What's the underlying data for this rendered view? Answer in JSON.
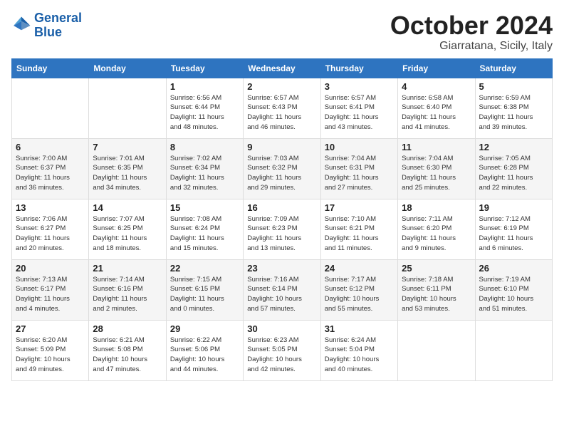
{
  "header": {
    "logo_general": "General",
    "logo_blue": "Blue",
    "month": "October 2024",
    "location": "Giarratana, Sicily, Italy"
  },
  "days_of_week": [
    "Sunday",
    "Monday",
    "Tuesday",
    "Wednesday",
    "Thursday",
    "Friday",
    "Saturday"
  ],
  "weeks": [
    [
      {
        "day": "",
        "info": ""
      },
      {
        "day": "",
        "info": ""
      },
      {
        "day": "1",
        "info": "Sunrise: 6:56 AM\nSunset: 6:44 PM\nDaylight: 11 hours\nand 48 minutes."
      },
      {
        "day": "2",
        "info": "Sunrise: 6:57 AM\nSunset: 6:43 PM\nDaylight: 11 hours\nand 46 minutes."
      },
      {
        "day": "3",
        "info": "Sunrise: 6:57 AM\nSunset: 6:41 PM\nDaylight: 11 hours\nand 43 minutes."
      },
      {
        "day": "4",
        "info": "Sunrise: 6:58 AM\nSunset: 6:40 PM\nDaylight: 11 hours\nand 41 minutes."
      },
      {
        "day": "5",
        "info": "Sunrise: 6:59 AM\nSunset: 6:38 PM\nDaylight: 11 hours\nand 39 minutes."
      }
    ],
    [
      {
        "day": "6",
        "info": "Sunrise: 7:00 AM\nSunset: 6:37 PM\nDaylight: 11 hours\nand 36 minutes."
      },
      {
        "day": "7",
        "info": "Sunrise: 7:01 AM\nSunset: 6:35 PM\nDaylight: 11 hours\nand 34 minutes."
      },
      {
        "day": "8",
        "info": "Sunrise: 7:02 AM\nSunset: 6:34 PM\nDaylight: 11 hours\nand 32 minutes."
      },
      {
        "day": "9",
        "info": "Sunrise: 7:03 AM\nSunset: 6:32 PM\nDaylight: 11 hours\nand 29 minutes."
      },
      {
        "day": "10",
        "info": "Sunrise: 7:04 AM\nSunset: 6:31 PM\nDaylight: 11 hours\nand 27 minutes."
      },
      {
        "day": "11",
        "info": "Sunrise: 7:04 AM\nSunset: 6:30 PM\nDaylight: 11 hours\nand 25 minutes."
      },
      {
        "day": "12",
        "info": "Sunrise: 7:05 AM\nSunset: 6:28 PM\nDaylight: 11 hours\nand 22 minutes."
      }
    ],
    [
      {
        "day": "13",
        "info": "Sunrise: 7:06 AM\nSunset: 6:27 PM\nDaylight: 11 hours\nand 20 minutes."
      },
      {
        "day": "14",
        "info": "Sunrise: 7:07 AM\nSunset: 6:25 PM\nDaylight: 11 hours\nand 18 minutes."
      },
      {
        "day": "15",
        "info": "Sunrise: 7:08 AM\nSunset: 6:24 PM\nDaylight: 11 hours\nand 15 minutes."
      },
      {
        "day": "16",
        "info": "Sunrise: 7:09 AM\nSunset: 6:23 PM\nDaylight: 11 hours\nand 13 minutes."
      },
      {
        "day": "17",
        "info": "Sunrise: 7:10 AM\nSunset: 6:21 PM\nDaylight: 11 hours\nand 11 minutes."
      },
      {
        "day": "18",
        "info": "Sunrise: 7:11 AM\nSunset: 6:20 PM\nDaylight: 11 hours\nand 9 minutes."
      },
      {
        "day": "19",
        "info": "Sunrise: 7:12 AM\nSunset: 6:19 PM\nDaylight: 11 hours\nand 6 minutes."
      }
    ],
    [
      {
        "day": "20",
        "info": "Sunrise: 7:13 AM\nSunset: 6:17 PM\nDaylight: 11 hours\nand 4 minutes."
      },
      {
        "day": "21",
        "info": "Sunrise: 7:14 AM\nSunset: 6:16 PM\nDaylight: 11 hours\nand 2 minutes."
      },
      {
        "day": "22",
        "info": "Sunrise: 7:15 AM\nSunset: 6:15 PM\nDaylight: 11 hours\nand 0 minutes."
      },
      {
        "day": "23",
        "info": "Sunrise: 7:16 AM\nSunset: 6:14 PM\nDaylight: 10 hours\nand 57 minutes."
      },
      {
        "day": "24",
        "info": "Sunrise: 7:17 AM\nSunset: 6:12 PM\nDaylight: 10 hours\nand 55 minutes."
      },
      {
        "day": "25",
        "info": "Sunrise: 7:18 AM\nSunset: 6:11 PM\nDaylight: 10 hours\nand 53 minutes."
      },
      {
        "day": "26",
        "info": "Sunrise: 7:19 AM\nSunset: 6:10 PM\nDaylight: 10 hours\nand 51 minutes."
      }
    ],
    [
      {
        "day": "27",
        "info": "Sunrise: 6:20 AM\nSunset: 5:09 PM\nDaylight: 10 hours\nand 49 minutes."
      },
      {
        "day": "28",
        "info": "Sunrise: 6:21 AM\nSunset: 5:08 PM\nDaylight: 10 hours\nand 47 minutes."
      },
      {
        "day": "29",
        "info": "Sunrise: 6:22 AM\nSunset: 5:06 PM\nDaylight: 10 hours\nand 44 minutes."
      },
      {
        "day": "30",
        "info": "Sunrise: 6:23 AM\nSunset: 5:05 PM\nDaylight: 10 hours\nand 42 minutes."
      },
      {
        "day": "31",
        "info": "Sunrise: 6:24 AM\nSunset: 5:04 PM\nDaylight: 10 hours\nand 40 minutes."
      },
      {
        "day": "",
        "info": ""
      },
      {
        "day": "",
        "info": ""
      }
    ]
  ]
}
